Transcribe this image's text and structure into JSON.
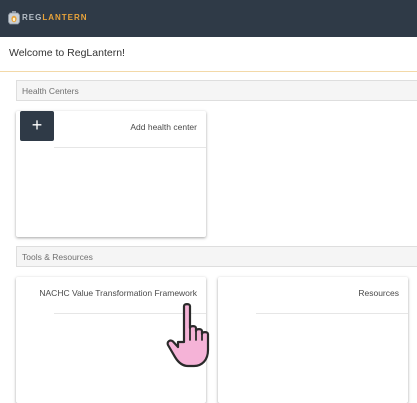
{
  "navbar": {
    "logo_reg": "REG",
    "logo_lantern": "LANTERN",
    "logo_icon": "lantern-logo-icon"
  },
  "welcome": {
    "text": "Welcome to RegLantern!"
  },
  "health_centers": {
    "heading": "Health Centers",
    "add_card": {
      "button_symbol": "+",
      "label": "Add health center"
    }
  },
  "tools_resources": {
    "heading": "Tools & Resources",
    "cards": [
      {
        "title": "NACHC Value Transformation Framework"
      },
      {
        "title": "Resources"
      }
    ]
  },
  "cursor": {
    "icon": "pointing-hand-cursor-icon",
    "color": "#f5b3d7"
  },
  "colors": {
    "navbar": "#2f3a47",
    "accent": "#e8a33a",
    "section_bg": "#f5f5f5"
  }
}
